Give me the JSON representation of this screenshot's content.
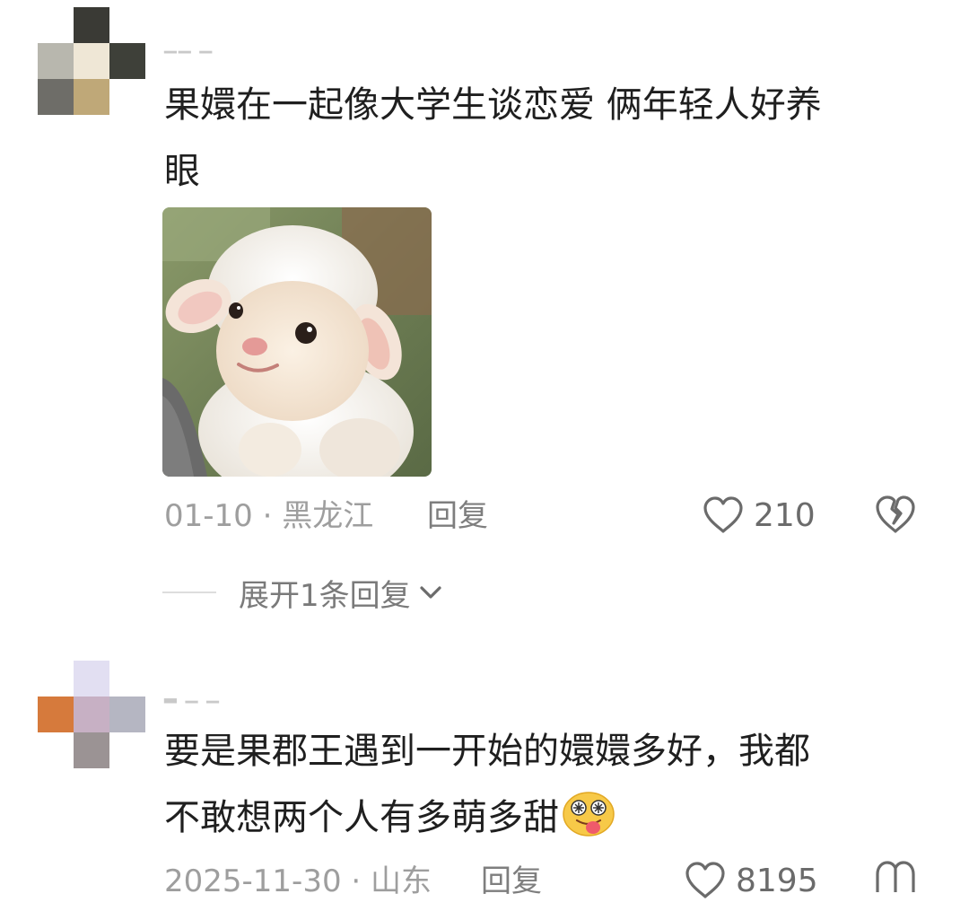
{
  "comments": [
    {
      "text_line1": "果嬛在一起像大学生谈恋爱 俩年轻人好养",
      "text_line2": "眼",
      "date": "01-10",
      "location": "黑龙江",
      "reply_label": "回复",
      "likes": "210",
      "expand_label": "展开1条回复"
    },
    {
      "text_line1": "要是果郡王遇到一开始的嬛嬛多好，我都",
      "text_line2": "不敢想两个人有多萌多甜",
      "date": "2025-11-30",
      "location": "山东",
      "reply_label": "回复",
      "likes": "8195"
    }
  ],
  "separator": " · ",
  "icons": {
    "like": "heart-outline-icon",
    "dislike": "broken-heart-icon",
    "expand": "chevron-down-icon",
    "emoji": "dizzy-tongue-emoji"
  },
  "colors": {
    "text_primary": "#1f1f1f",
    "text_meta": "#9e9e9e",
    "icon": "#6b6b6b"
  }
}
